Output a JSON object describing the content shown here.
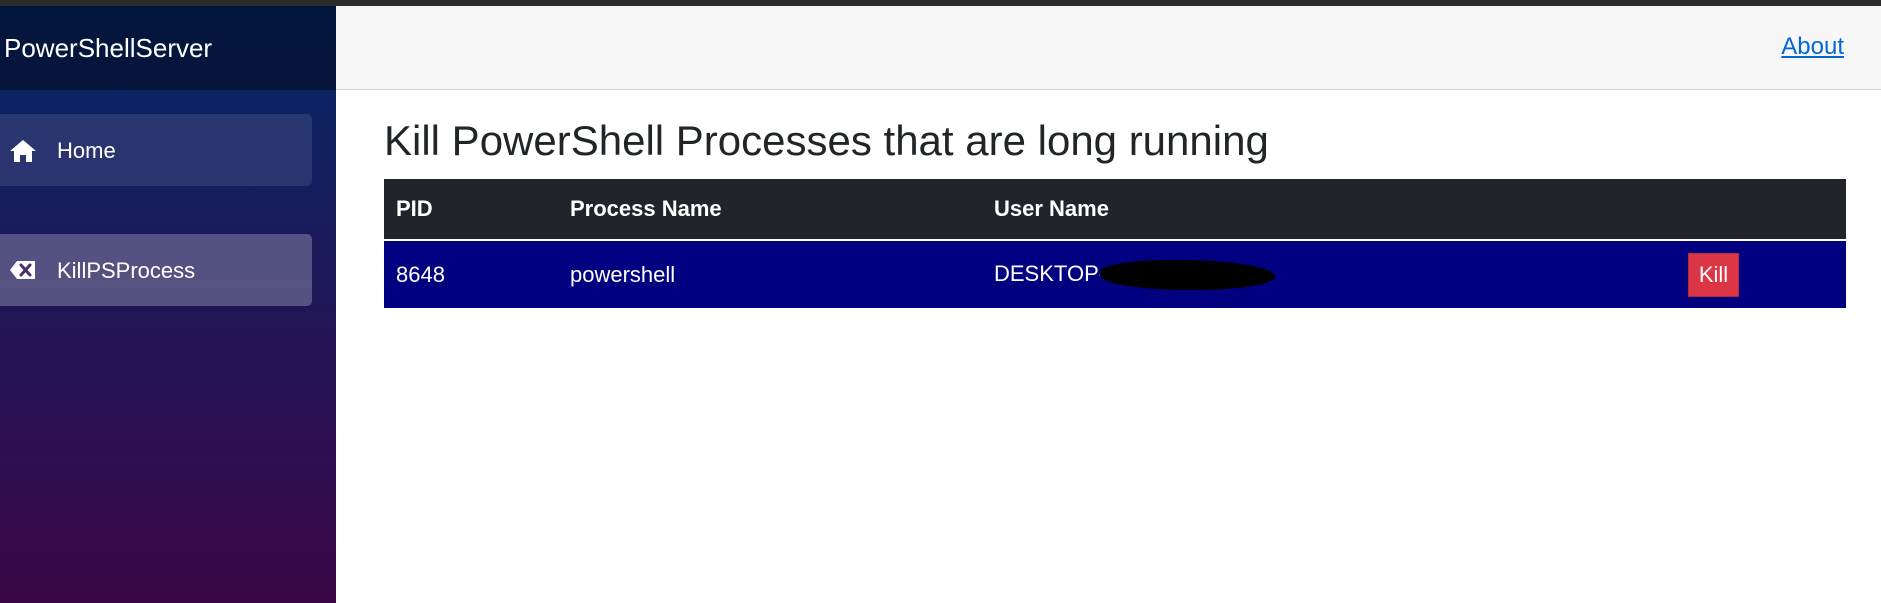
{
  "sidebar": {
    "brand": "PowerShellServer",
    "items": [
      {
        "label": "Home",
        "icon": "home-icon"
      },
      {
        "label": "KillPSProcess",
        "icon": "backspace-x-icon"
      }
    ]
  },
  "header": {
    "about_label": "About"
  },
  "main": {
    "title": "Kill PowerShell Processes that are long running",
    "table": {
      "columns": [
        "PID",
        "Process Name",
        "User Name",
        ""
      ],
      "rows": [
        {
          "pid": "8648",
          "process_name": "powershell",
          "user_name": "DESKTOP-",
          "action_label": "Kill"
        }
      ]
    }
  },
  "colors": {
    "sidebar_top": "#052767",
    "sidebar_bottom": "#3a0647",
    "table_header": "#212529",
    "row_highlight": "#000080",
    "kill_button": "#dc3545",
    "link": "#0366d6"
  }
}
